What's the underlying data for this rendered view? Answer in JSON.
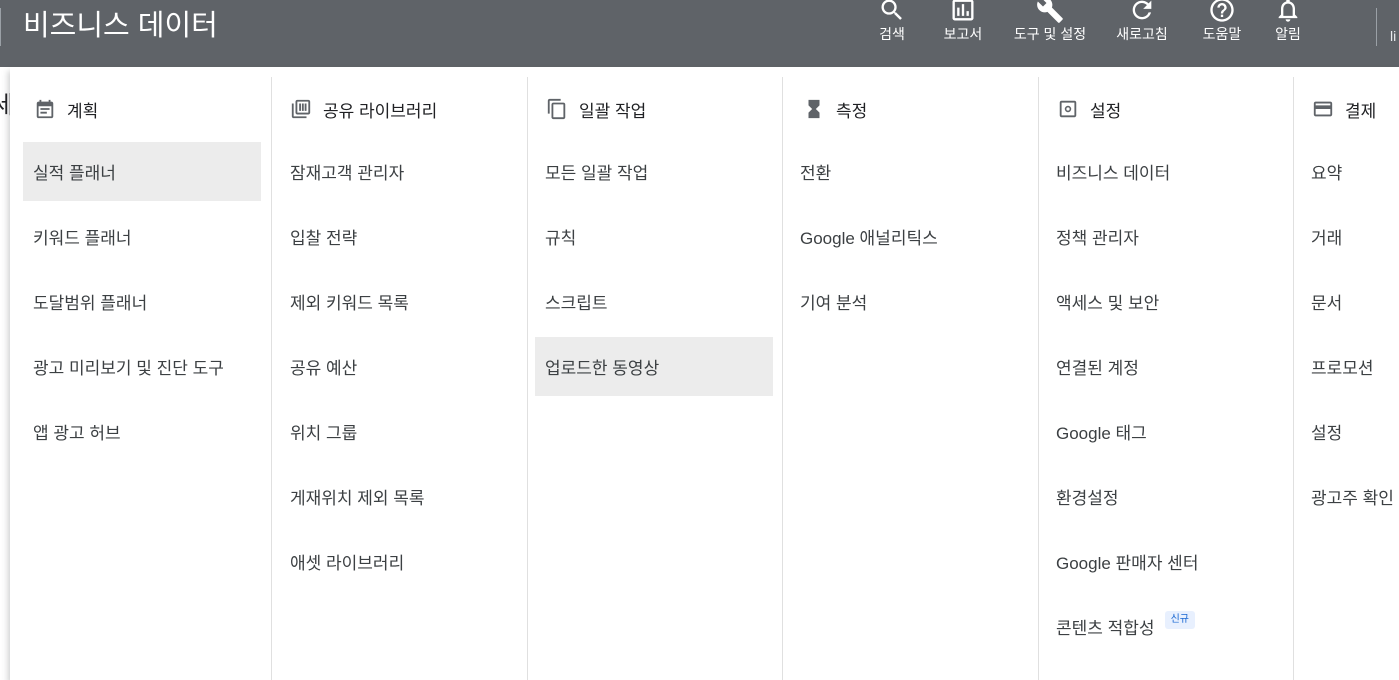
{
  "header": {
    "title": "비즈니스 데이터",
    "actions": [
      {
        "label": "검색",
        "icon": "search-icon"
      },
      {
        "label": "보고서",
        "icon": "reports-icon"
      },
      {
        "label": "도구 및 설정",
        "icon": "wrench-icon"
      },
      {
        "label": "새로고침",
        "icon": "refresh-icon"
      },
      {
        "label": "도움말",
        "icon": "help-icon"
      },
      {
        "label": "알림",
        "icon": "bell-icon"
      }
    ],
    "account_stub": "li",
    "behind_stub": "세"
  },
  "colors": {
    "header_bg": "#5f6368",
    "selected_bg": "#ececec",
    "badge_bg": "#e8f0fe",
    "badge_text": "#1967d2"
  },
  "menu": {
    "columns": [
      {
        "title": "계획",
        "icon": "calendar-icon",
        "items": [
          "실적 플래너",
          "키워드 플래너",
          "도달범위 플래너",
          "광고 미리보기 및 진단 도구",
          "앱 광고 허브"
        ]
      },
      {
        "title": "공유 라이브러리",
        "icon": "library-icon",
        "items": [
          "잠재고객 관리자",
          "입찰 전략",
          "제외 키워드 목록",
          "공유 예산",
          "위치 그룹",
          "게재위치 제외 목록",
          "애셋 라이브러리"
        ]
      },
      {
        "title": "일괄 작업",
        "icon": "copy-icon",
        "items": [
          "모든 일괄 작업",
          "규칙",
          "스크립트",
          "업로드한 동영상"
        ]
      },
      {
        "title": "측정",
        "icon": "hourglass-icon",
        "items": [
          "전환",
          "Google 애널리틱스",
          "기여 분석"
        ]
      },
      {
        "title": "설정",
        "icon": "settings-icon",
        "items": [
          "비즈니스 데이터",
          "정책 관리자",
          "액세스 및 보안",
          "연결된 계정",
          "Google 태그",
          "환경설정",
          "Google 판매자 센터",
          "콘텐츠 적합성"
        ],
        "badge": "신규"
      },
      {
        "title": "결제",
        "icon": "credit-card-icon",
        "items": [
          "요약",
          "거래",
          "문서",
          "프로모션",
          "설정",
          "광고주 확인"
        ]
      }
    ],
    "selected": [
      "실적 플래너",
      "업로드한 동영상"
    ]
  }
}
